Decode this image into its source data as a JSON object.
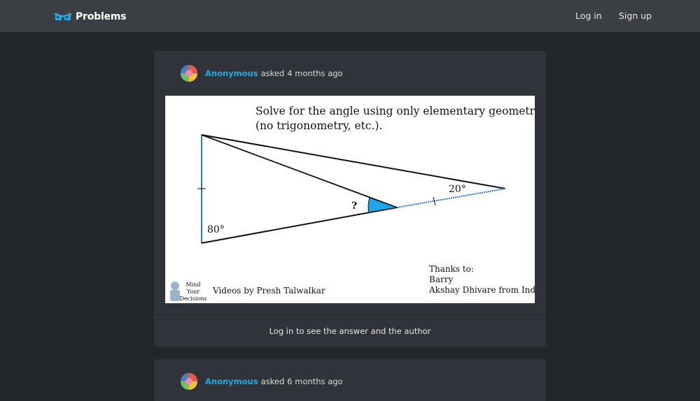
{
  "header": {
    "brand_label": "Problems",
    "brand_icon": "glasses-icon",
    "login_label": "Log in",
    "signup_label": "Sign up"
  },
  "posts": [
    {
      "author": "Anonymous",
      "asked_label": "asked",
      "time": "4 months ago",
      "cta_label": "Log in to see the answer and the author",
      "figure": {
        "title_line1": "Solve for the angle using only elementary geometry",
        "title_line2": "(no trigonometry, etc.).",
        "angle_right": "20°",
        "angle_left": "80°",
        "unknown": "?",
        "logo_line1": "Mind",
        "logo_line2": "Your",
        "logo_line3": "Decisions",
        "videos_by": "Videos by Presh Talwalkar",
        "thanks_title": "Thanks to:",
        "thanks_1": "Barry",
        "thanks_2": "Akshay Dhivare from India"
      }
    },
    {
      "author": "Anonymous",
      "asked_label": "asked",
      "time": "6 months ago"
    }
  ],
  "colors": {
    "accent": "#26a9e0",
    "topbar": "#3b3e42",
    "card": "#30343a",
    "page": "#24272a"
  }
}
